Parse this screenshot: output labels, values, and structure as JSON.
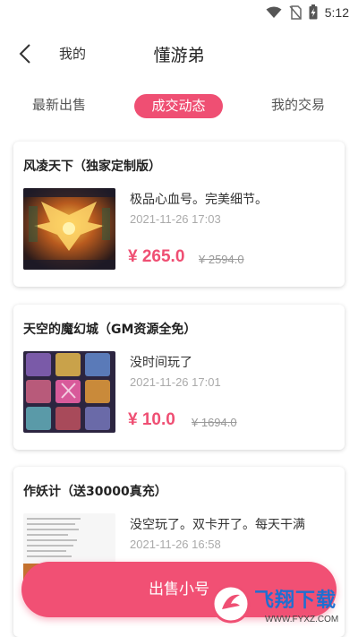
{
  "status_bar": {
    "time": "5:12"
  },
  "header": {
    "back_label": "我的",
    "title": "懂游弟"
  },
  "tabs": [
    {
      "label": "最新出售"
    },
    {
      "label": "成交动态"
    },
    {
      "label": "我的交易"
    }
  ],
  "deals": [
    {
      "game": "风凌天下（独家定制版）",
      "description": "极品心血号。完美细节。",
      "time": "2021-11-26 17:03",
      "price": "¥ 265.0",
      "original_price": "¥ 2594.0"
    },
    {
      "game": "天空的魔幻城（GM资源全免）",
      "description": "没时间玩了",
      "time": "2021-11-26 17:01",
      "price": "¥ 10.0",
      "original_price": "¥ 1694.0"
    },
    {
      "game": "作妖计（送30000真充）",
      "description": "没空玩了。双卡开了。每天干满",
      "time": "2021-11-26 16:58"
    }
  ],
  "sell_button": {
    "label": "出售小号"
  },
  "watermark": {
    "brand": "飞翔下载",
    "url": "WWW.FYXZ.COM"
  },
  "colors": {
    "accent": "#ef4f73"
  }
}
